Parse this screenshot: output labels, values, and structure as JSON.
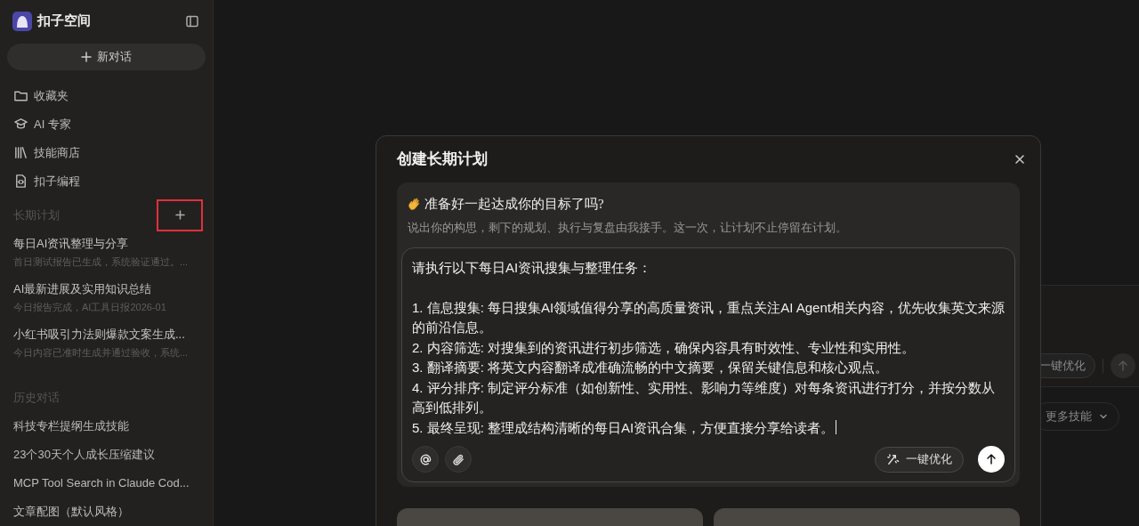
{
  "app": {
    "name": "扣子空间"
  },
  "sidebar": {
    "new_chat": "新对话",
    "nav": [
      {
        "label": "收藏夹"
      },
      {
        "label": "AI 专家"
      },
      {
        "label": "技能商店"
      },
      {
        "label": "扣子编程"
      }
    ],
    "plans": {
      "heading": "长期计划",
      "items": [
        {
          "title": "每日AI资讯整理与分享",
          "subtitle": "首日测试报告已生成，系统验证通过。..."
        },
        {
          "title": "AI最新进展及实用知识总结",
          "subtitle": "今日报告完成，AI工具日报2026-01"
        },
        {
          "title": "小红书吸引力法则爆款文案生成...",
          "subtitle": "今日内容已准时生成并通过验收，系统..."
        }
      ]
    },
    "history": {
      "heading": "历史对话",
      "items": [
        {
          "title": "科技专栏提纲生成技能"
        },
        {
          "title": "23个30天个人成长压缩建议"
        },
        {
          "title": "MCP Tool Search in Claude Cod..."
        },
        {
          "title": "文章配图（默认风格）"
        }
      ]
    }
  },
  "background": {
    "optimize_button": "一键优化",
    "more_skills": "更多技能"
  },
  "modal": {
    "title": "创建长期计划",
    "intro": {
      "heading": "准备好一起达成你的目标了吗?",
      "text": "说出你的构思，剩下的规划、执行与复盘由我接手。这一次，让计划不止停留在计划。"
    },
    "prompt": {
      "opening": "请执行以下每日AI资讯搜集与整理任务：",
      "steps": [
        "1. 信息搜集: 每日搜集AI领域值得分享的高质量资讯，重点关注AI Agent相关内容，优先收集英文来源的前沿信息。",
        "2. 内容筛选: 对搜集到的资讯进行初步筛选，确保内容具有时效性、专业性和实用性。",
        "3. 翻译摘要: 将英文内容翻译成准确流畅的中文摘要，保留关键信息和核心观点。",
        "4. 评分排序: 制定评分标准（如创新性、实用性、影响力等维度）对每条资讯进行打分，并按分数从高到低排列。",
        "5. 最终呈现: 整理成结构清晰的每日AI资讯合集，方便直接分享给读者。"
      ]
    },
    "optimize_button": "一键优化"
  }
}
